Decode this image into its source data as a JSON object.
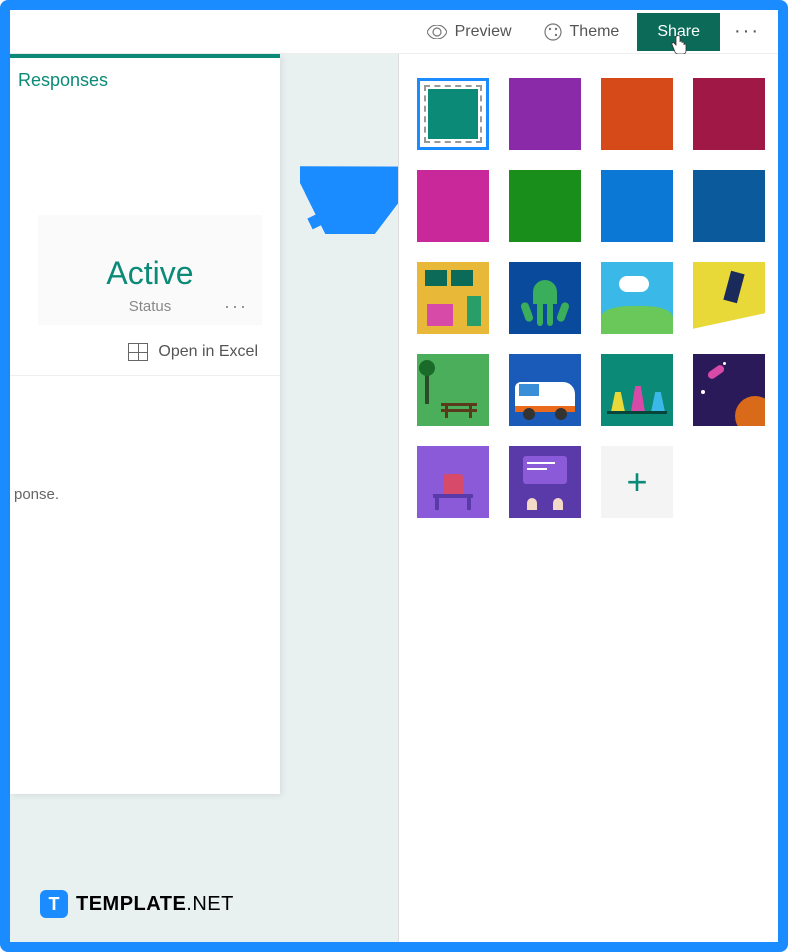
{
  "toolbar": {
    "preview": "Preview",
    "theme": "Theme",
    "share": "Share"
  },
  "tabs": {
    "responses": "Responses"
  },
  "status": {
    "value": "Active",
    "label": "Status"
  },
  "actions": {
    "open_excel": "Open in Excel"
  },
  "body": {
    "response_fragment": "ponse."
  },
  "themes": {
    "colors": [
      {
        "name": "teal",
        "hex": "#0b8a77",
        "selected": true
      },
      {
        "name": "purple",
        "hex": "#8a2aa8"
      },
      {
        "name": "orange",
        "hex": "#d64a1a"
      },
      {
        "name": "crimson",
        "hex": "#a01846"
      },
      {
        "name": "magenta",
        "hex": "#c8289a"
      },
      {
        "name": "green",
        "hex": "#1a8e1a"
      },
      {
        "name": "blue",
        "hex": "#0a78d4"
      },
      {
        "name": "darkblue",
        "hex": "#0a5a9c"
      }
    ],
    "illustrations": [
      "room",
      "octopus",
      "cloud-hill",
      "snowboarder",
      "park",
      "van",
      "chemistry",
      "space",
      "desk",
      "presentation"
    ],
    "add_label": "+"
  },
  "watermark": {
    "badge": "T",
    "text_bold": "TEMPLATE",
    "text_light": ".NET"
  }
}
